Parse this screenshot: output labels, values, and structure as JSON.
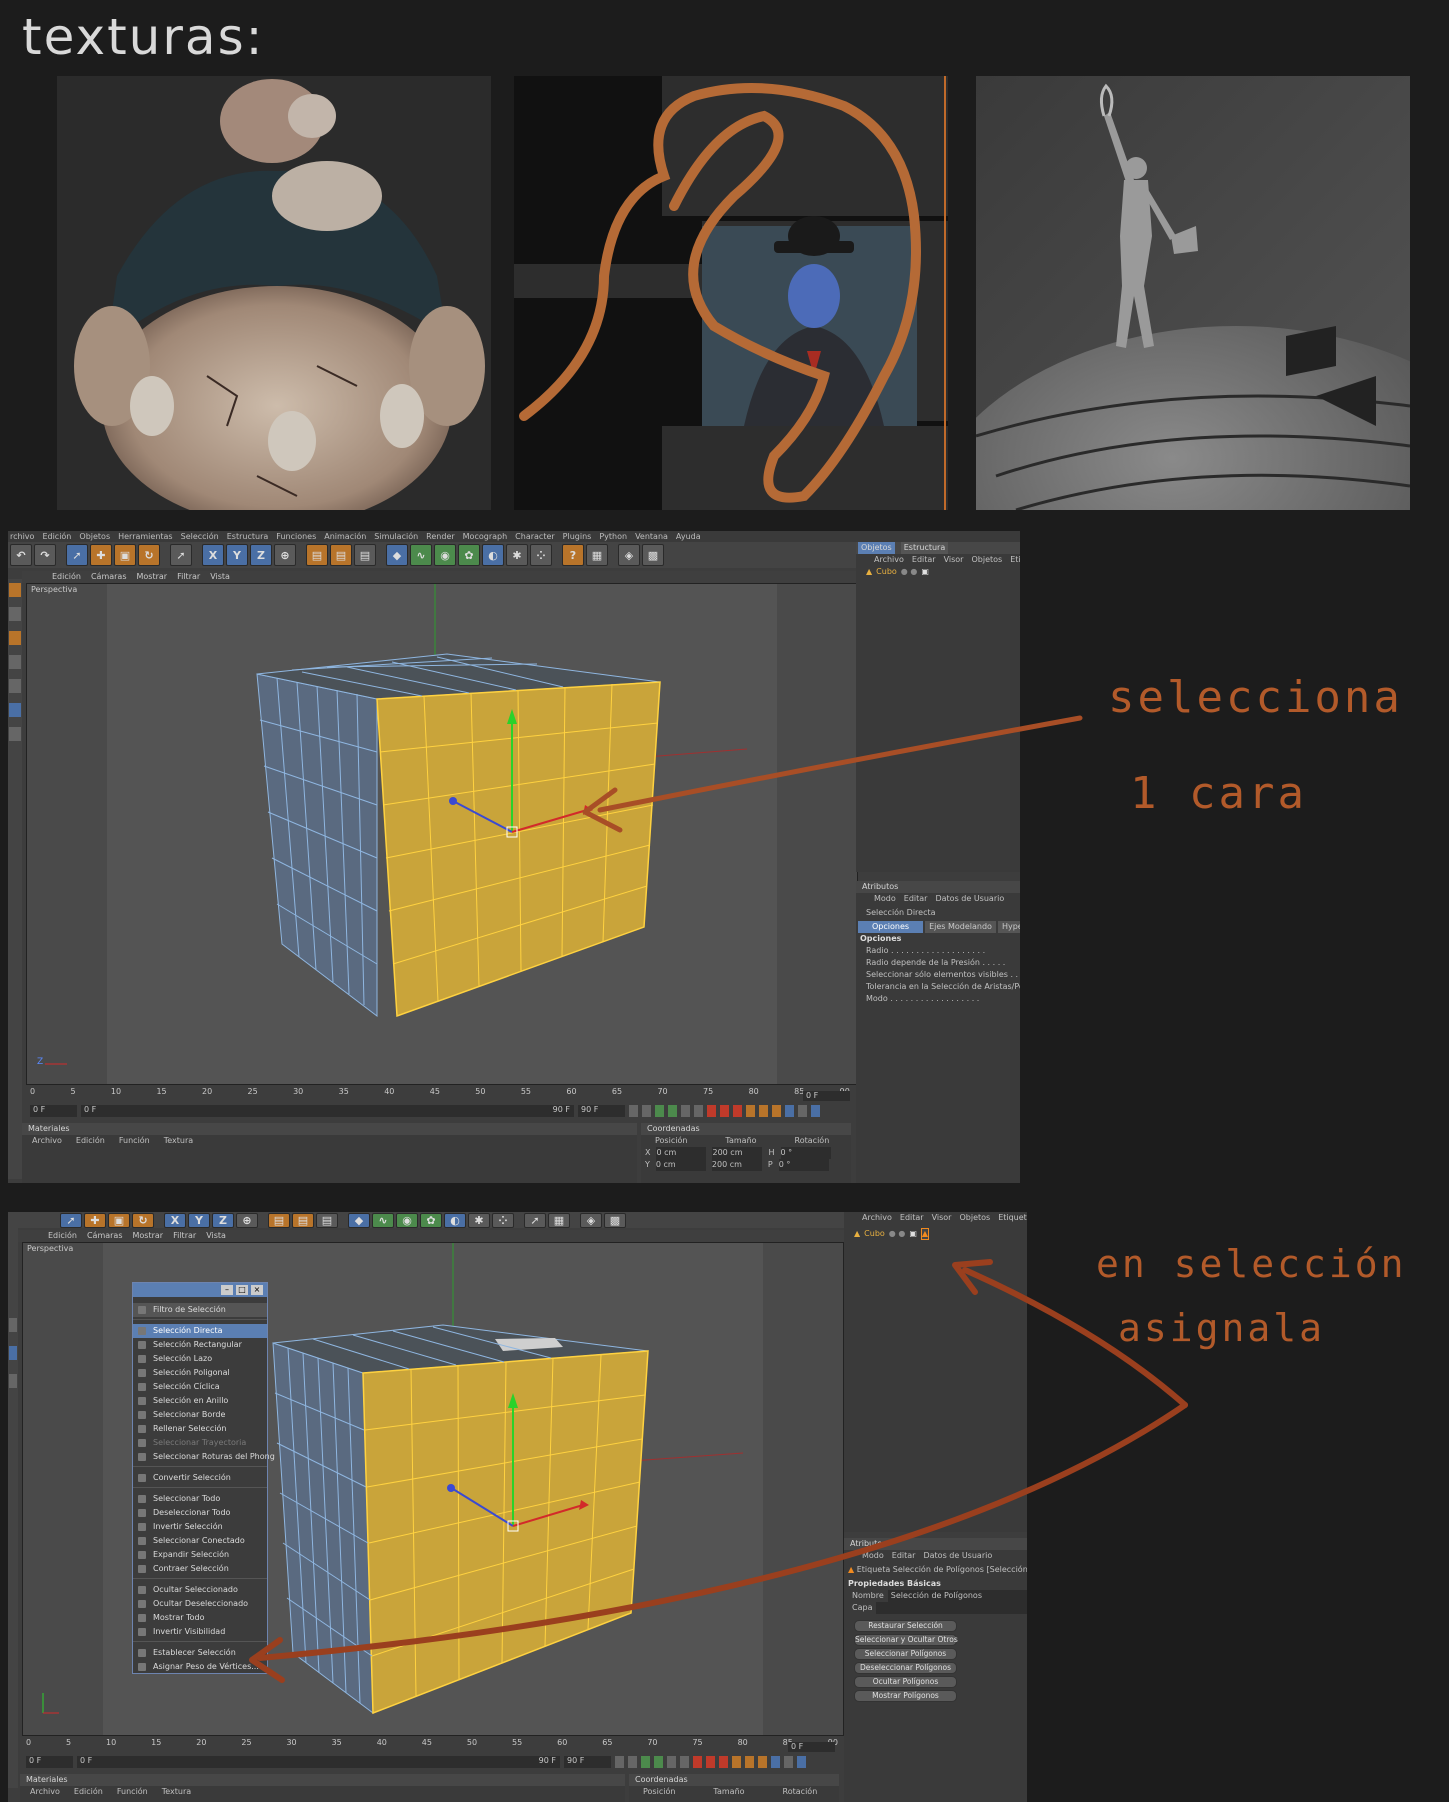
{
  "page_title": "texturas:",
  "thumbnails": [
    {
      "name": "fat-zombie-render"
    },
    {
      "name": "magritte-rope-render"
    },
    {
      "name": "gardener-statue-render"
    }
  ],
  "c4d_top": {
    "menu": [
      "rchivo",
      "Edición",
      "Objetos",
      "Herramientas",
      "Selección",
      "Estructura",
      "Funciones",
      "Animación",
      "Simulación",
      "Render",
      "Mocograph",
      "Character",
      "Plugins",
      "Python",
      "Ventana",
      "Ayuda"
    ],
    "viewport_menu": [
      "Edición",
      "Cámaras",
      "Mostrar",
      "Filtrar",
      "Vista"
    ],
    "viewport_label": "Perspectiva",
    "objects_tabs": [
      "Objetos",
      "Estructura"
    ],
    "objects_menu": [
      "Archivo",
      "Editar",
      "Visor",
      "Objetos",
      "Etiqueta"
    ],
    "object_name": "Cubo",
    "attributes_header": "Atributos",
    "attributes_menu": [
      "Modo",
      "Editar",
      "Datos de Usuario"
    ],
    "tool_name": "Selección Directa",
    "tabs": [
      "Opciones",
      "Ejes Modelando",
      "HyperNURBS"
    ],
    "options_header": "Opciones",
    "options": [
      "Radio . . . . . . . . . . . . . . . . . . .",
      "Radio depende de la Presión . . . . .",
      "Seleccionar sólo elementos visibles . . . . . . . . .",
      "Tolerancia en la Selección de Aristas/Polígonos",
      "Modo . . . . . . . . . . . . . . . . . ."
    ],
    "timeline_ticks": [
      "0",
      "5",
      "10",
      "15",
      "20",
      "25",
      "30",
      "35",
      "40",
      "45",
      "50",
      "55",
      "60",
      "65",
      "70",
      "75",
      "80",
      "85",
      "90"
    ],
    "frame_current": "0 F",
    "frame_start": "0 F",
    "frame_field": "0 F",
    "frame_end": "90 F",
    "frame_end2": "90 F",
    "materials_header": "Materiales",
    "materials_menu": [
      "Archivo",
      "Edición",
      "Función",
      "Textura"
    ],
    "coords_header": "Coordenadas",
    "coords_cols": [
      "Posición",
      "Tamaño",
      "Rotación"
    ],
    "coords_rows": [
      {
        "axis": "X",
        "pos": "0 cm",
        "size": "200 cm",
        "rot_axis": "H",
        "rot": "0 °"
      },
      {
        "axis": "Y",
        "pos": "0 cm",
        "size": "200 cm",
        "rot_axis": "P",
        "rot": "0 °"
      }
    ]
  },
  "c4d_bottom": {
    "viewport_menu": [
      "Edición",
      "Cámaras",
      "Mostrar",
      "Filtrar",
      "Vista"
    ],
    "viewport_label": "Perspectiva",
    "objects_menu": [
      "Archivo",
      "Editar",
      "Visor",
      "Objetos",
      "Etiquetas"
    ],
    "object_name": "Cubo",
    "selection_menu": {
      "header": "Filtro de Selección",
      "groups": [
        [
          {
            "label": "Selección Directa",
            "state": "selected"
          },
          {
            "label": "Selección Rectangular",
            "state": ""
          },
          {
            "label": "Selección Lazo",
            "state": ""
          },
          {
            "label": "Selección Poligonal",
            "state": ""
          },
          {
            "label": "Selección Cíclica",
            "state": ""
          },
          {
            "label": "Selección en Anillo",
            "state": ""
          },
          {
            "label": "Seleccionar Borde",
            "state": ""
          },
          {
            "label": "Rellenar Selección",
            "state": ""
          },
          {
            "label": "Seleccionar Trayectoria",
            "state": "disabled"
          },
          {
            "label": "Seleccionar Roturas del Phong",
            "state": ""
          }
        ],
        [
          {
            "label": "Convertir Selección",
            "state": ""
          }
        ],
        [
          {
            "label": "Seleccionar Todo",
            "state": ""
          },
          {
            "label": "Deseleccionar Todo",
            "state": ""
          },
          {
            "label": "Invertir Selección",
            "state": ""
          },
          {
            "label": "Seleccionar Conectado",
            "state": ""
          },
          {
            "label": "Expandir Selección",
            "state": ""
          },
          {
            "label": "Contraer Selección",
            "state": ""
          }
        ],
        [
          {
            "label": "Ocultar Seleccionado",
            "state": ""
          },
          {
            "label": "Ocultar Deseleccionado",
            "state": ""
          },
          {
            "label": "Mostrar Todo",
            "state": ""
          },
          {
            "label": "Invertir Visibilidad",
            "state": ""
          }
        ],
        [
          {
            "label": "Establecer Selección",
            "state": ""
          },
          {
            "label": "Asignar Peso de Vértices...",
            "state": ""
          }
        ]
      ]
    },
    "attributes_header": "Atributos",
    "attributes_menu": [
      "Modo",
      "Editar",
      "Datos de Usuario"
    ],
    "tag_name": "Etiqueta Selección de Polígonos [Selección de Polígonos]",
    "basic_props_header": "Propiedades Básicas",
    "name_label": "Nombre",
    "name_value": "Selección de Polígonos",
    "layer_label": "Capa",
    "buttons": [
      "Restaurar Selección",
      "Seleccionar y Ocultar Otros",
      "Seleccionar Polígonos",
      "Deseleccionar Polígonos",
      "Ocultar Polígonos",
      "Mostrar Polígonos"
    ],
    "timeline_ticks": [
      "0",
      "5",
      "10",
      "15",
      "20",
      "25",
      "30",
      "35",
      "40",
      "45",
      "50",
      "55",
      "60",
      "65",
      "70",
      "75",
      "80",
      "85",
      "90"
    ],
    "frame_current": "0 F",
    "frame_start": "0 F",
    "frame_field": "0 F",
    "frame_end": "90 F",
    "frame_end2": "90 F",
    "materials_header": "Materiales",
    "materials_menu": [
      "Archivo",
      "Edición",
      "Función",
      "Textura"
    ],
    "coords_header": "Coordenadas",
    "coords_cols": [
      "Posición",
      "Tamaño",
      "Rotación"
    ]
  },
  "annotations": {
    "top_line1": "selecciona",
    "top_line2": "1 cara",
    "bottom_line1": "en selección",
    "bottom_line2": "asignala"
  },
  "colors": {
    "background": "#1c1c1c",
    "ui_panel": "#3d3d3d",
    "selected_face": "#c9a43a",
    "annotation": "#b25a2a",
    "highlight": "#5b7fb3"
  }
}
